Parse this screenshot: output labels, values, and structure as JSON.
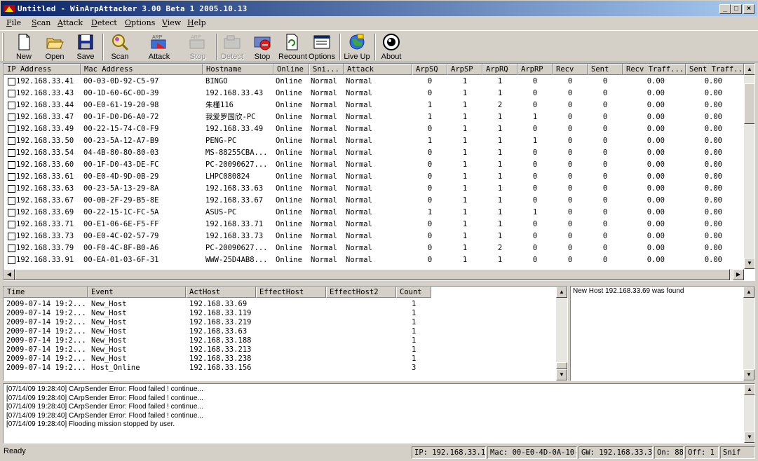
{
  "window": {
    "title": "Untitled - WinArpAttacker 3.00 Beta 1 2005.10.13"
  },
  "menu": [
    "File",
    "Scan",
    "Attack",
    "Detect",
    "Options",
    "View",
    "Help"
  ],
  "toolbar": [
    {
      "label": "New",
      "icon": "new-document-icon",
      "enabled": true
    },
    {
      "label": "Open",
      "icon": "open-folder-icon",
      "enabled": true
    },
    {
      "label": "Save",
      "icon": "floppy-disk-icon",
      "enabled": true
    },
    {
      "label": "Scan",
      "icon": "scan-icon",
      "enabled": true
    },
    {
      "label": "Attack",
      "icon": "arp-attack-icon",
      "enabled": true
    },
    {
      "label": "Stop",
      "icon": "arp-stop-icon",
      "enabled": false
    },
    {
      "label": "Detect",
      "icon": "detect-icon",
      "enabled": false
    },
    {
      "label": "Stop",
      "icon": "stop-icon",
      "enabled": true
    },
    {
      "label": "Recount",
      "icon": "recount-icon",
      "enabled": true
    },
    {
      "label": "Options",
      "icon": "options-icon",
      "enabled": true
    },
    {
      "label": "Live Up",
      "icon": "globe-icon",
      "enabled": true
    },
    {
      "label": "About",
      "icon": "about-icon",
      "enabled": true
    }
  ],
  "hosts": {
    "columns": [
      "IP Address",
      "Mac Address",
      "Hostname",
      "Online",
      "Sni...",
      "Attack",
      "ArpSQ",
      "ArpSP",
      "ArpRQ",
      "ArpRP",
      "Recv",
      "Sent",
      "Recv Traff...",
      "Sent Traff..."
    ],
    "rows": [
      [
        "192.168.33.41",
        "00-03-0D-92-C5-97",
        "BINGO",
        "Online",
        "Normal",
        "Normal",
        "0",
        "1",
        "1",
        "0",
        "0",
        "0",
        "0.00",
        "0.00"
      ],
      [
        "192.168.33.43",
        "00-1D-60-6C-0D-39",
        "192.168.33.43",
        "Online",
        "Normal",
        "Normal",
        "0",
        "1",
        "1",
        "0",
        "0",
        "0",
        "0.00",
        "0.00"
      ],
      [
        "192.168.33.44",
        "00-E0-61-19-20-98",
        "朱槿116",
        "Online",
        "Normal",
        "Normal",
        "1",
        "1",
        "2",
        "0",
        "0",
        "0",
        "0.00",
        "0.00"
      ],
      [
        "192.168.33.47",
        "00-1F-D0-D6-A0-72",
        "我爱罗国欣-PC",
        "Online",
        "Normal",
        "Normal",
        "1",
        "1",
        "1",
        "1",
        "0",
        "0",
        "0.00",
        "0.00"
      ],
      [
        "192.168.33.49",
        "00-22-15-74-C0-F9",
        "192.168.33.49",
        "Online",
        "Normal",
        "Normal",
        "0",
        "1",
        "1",
        "0",
        "0",
        "0",
        "0.00",
        "0.00"
      ],
      [
        "192.168.33.50",
        "00-23-5A-12-A7-B9",
        "PENG-PC",
        "Online",
        "Normal",
        "Normal",
        "1",
        "1",
        "1",
        "1",
        "0",
        "0",
        "0.00",
        "0.00"
      ],
      [
        "192.168.33.54",
        "04-4B-80-80-80-03",
        "MS-88255CBA...",
        "Online",
        "Normal",
        "Normal",
        "0",
        "1",
        "1",
        "0",
        "0",
        "0",
        "0.00",
        "0.00"
      ],
      [
        "192.168.33.60",
        "00-1F-D0-43-DE-FC",
        "PC-20090627...",
        "Online",
        "Normal",
        "Normal",
        "0",
        "1",
        "1",
        "0",
        "0",
        "0",
        "0.00",
        "0.00"
      ],
      [
        "192.168.33.61",
        "00-E0-4D-9D-0B-29",
        "LHPC080824",
        "Online",
        "Normal",
        "Normal",
        "0",
        "1",
        "1",
        "0",
        "0",
        "0",
        "0.00",
        "0.00"
      ],
      [
        "192.168.33.63",
        "00-23-5A-13-29-8A",
        "192.168.33.63",
        "Online",
        "Normal",
        "Normal",
        "0",
        "1",
        "1",
        "0",
        "0",
        "0",
        "0.00",
        "0.00"
      ],
      [
        "192.168.33.67",
        "00-0B-2F-29-B5-8E",
        "192.168.33.67",
        "Online",
        "Normal",
        "Normal",
        "0",
        "1",
        "1",
        "0",
        "0",
        "0",
        "0.00",
        "0.00"
      ],
      [
        "192.168.33.69",
        "00-22-15-1C-FC-5A",
        "ASUS-PC",
        "Online",
        "Normal",
        "Normal",
        "1",
        "1",
        "1",
        "1",
        "0",
        "0",
        "0.00",
        "0.00"
      ],
      [
        "192.168.33.71",
        "00-E1-06-6E-F5-FF",
        "192.168.33.71",
        "Online",
        "Normal",
        "Normal",
        "0",
        "1",
        "1",
        "0",
        "0",
        "0",
        "0.00",
        "0.00"
      ],
      [
        "192.168.33.73",
        "00-E0-4C-02-57-79",
        "192.168.33.73",
        "Online",
        "Normal",
        "Normal",
        "0",
        "1",
        "1",
        "0",
        "0",
        "0",
        "0.00",
        "0.00"
      ],
      [
        "192.168.33.79",
        "00-F0-4C-8F-B0-A6",
        "PC-20090627...",
        "Online",
        "Normal",
        "Normal",
        "0",
        "1",
        "2",
        "0",
        "0",
        "0",
        "0.00",
        "0.00"
      ],
      [
        "192.168.33.91",
        "00-EA-01-03-6F-31",
        "WWW-25D4AB8...",
        "Online",
        "Normal",
        "Normal",
        "0",
        "1",
        "1",
        "0",
        "0",
        "0",
        "0.00",
        "0.00"
      ]
    ]
  },
  "events": {
    "columns": [
      "Time",
      "Event",
      "ActHost",
      "EffectHost",
      "EffectHost2",
      "Count"
    ],
    "rows": [
      [
        "2009-07-14 19:2...",
        "New_Host",
        "192.168.33.69",
        "",
        "",
        "1"
      ],
      [
        "2009-07-14 19:2...",
        "New_Host",
        "192.168.33.119",
        "",
        "",
        "1"
      ],
      [
        "2009-07-14 19:2...",
        "New_Host",
        "192.168.33.219",
        "",
        "",
        "1"
      ],
      [
        "2009-07-14 19:2...",
        "New_Host",
        "192.168.33.63",
        "",
        "",
        "1"
      ],
      [
        "2009-07-14 19:2...",
        "New_Host",
        "192.168.33.188",
        "",
        "",
        "1"
      ],
      [
        "2009-07-14 19:2...",
        "New_Host",
        "192.168.33.213",
        "",
        "",
        "1"
      ],
      [
        "2009-07-14 19:2...",
        "New_Host",
        "192.168.33.238",
        "",
        "",
        "1"
      ],
      [
        "2009-07-14 19:2...",
        "Host_Online",
        "192.168.33.156",
        "",
        "",
        "3"
      ]
    ]
  },
  "detail": {
    "text": "New Host 192.168.33.69 was found"
  },
  "log": [
    "[07/14/09 19:28:40] CArpSender Error: Flood failed ! continue...",
    "[07/14/09 19:28:40] CArpSender Error: Flood failed ! continue...",
    "[07/14/09 19:28:40] CArpSender Error: Flood failed ! continue...",
    "[07/14/09 19:28:40] CArpSender Error: Flood failed ! continue...",
    "[07/14/09 19:28:40] Flooding mission stopped by user."
  ],
  "status": {
    "ready": "Ready",
    "ip": "IP: 192.168.33.17",
    "mac": "Mac: 00-E0-4D-0A-10-1",
    "gw": "GW: 192.168.33.33",
    "on": "On: 88",
    "off": "Off: 1",
    "snif": "Snif"
  }
}
